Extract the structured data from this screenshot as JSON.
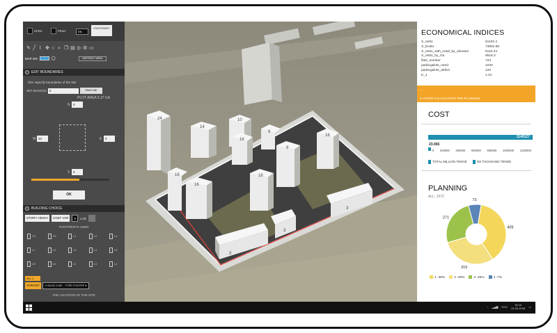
{
  "app": {
    "toolbar": {
      "open": "OPEN",
      "print": "PRINT",
      "lang": "EN",
      "start_reset": "START/RESET"
    },
    "map_on_label": "MAP ON",
    "abstract_label": "ABSTRACT AREA",
    "edit_boundaries": {
      "header": "EDIT BOUNDARIES",
      "hint": "-hint: Specify boundaries of the site",
      "setback_label": "SET BACK(m)",
      "setback_value": "6",
      "snapline": "SNAPLINE",
      "plot_area": "PLOT AREA 5.37 GA",
      "n_label": "N",
      "n_value": "0",
      "w_label": "W",
      "w_value": "10",
      "e_label": "E",
      "e_value": "0",
      "s_label": "S",
      "s_value": "5",
      "slider_fraction": 0.62,
      "ok": "OK"
    },
    "building_choice": {
      "header": "BUILDING CHOICE",
      "story_height": "STORY HEIGH",
      "coef_var": "COEF VAR",
      "coef_value": "0",
      "lub": "LUB",
      "footprints_used": "FOOTPRINTS USED",
      "footprints_row1": [
        "CC",
        "C3",
        "L1",
        "L2",
        "L3"
      ],
      "footprints_row2": [
        "L1",
        "L2",
        "L3",
        "L4",
        "L5"
      ],
      "footprints_row3": [
        "U2",
        "U1",
        "L2",
        "L3",
        "L4"
      ],
      "all_label": "ALL 1",
      "variant_label": "VARIANT",
      "variant_value": "0    51102.4 M2",
      "variant_type": "TYPE FOOTPF",
      "location": "THE LOCATION OF THE SITE"
    }
  },
  "map": {
    "building_labels": [
      "24",
      "14",
      "10",
      "16",
      "16",
      "9",
      "16",
      "16",
      "3",
      "3",
      "9",
      "16",
      "3"
    ]
  },
  "economical": {
    "title": "ECONOMICAL INDICES",
    "rows": [
      {
        "name": "S_netto",
        "value": "51102.4"
      },
      {
        "name": "S_brutto",
        "value": "73802.88"
      },
      {
        "name": "S_netto_with_retail_by_elevator",
        "value": "5110.24"
      },
      {
        "name": "S_netto_by_Ga",
        "value": "9516.3"
      },
      {
        "name": "flats_number",
        "value": "724"
      },
      {
        "name": "parkingslots_need",
        "value": "1030"
      },
      {
        "name": "parkingslots_deficit",
        "value": "120"
      },
      {
        "name": "K_1",
        "value": "1.44"
      }
    ],
    "orange_line1": "...",
    "orange_line2": "AFTER CALCULATING THE PLANNING"
  },
  "cost": {
    "title": "COST",
    "bar_value_label": "1140127",
    "small_value_label": "23.065",
    "ticks": [
      "0",
      "200000",
      "400000",
      "600000",
      "800000",
      "1000000",
      "1200000"
    ],
    "legend": [
      "TOTAL MILLION TENGE",
      "M2 THOUSAND TENGE"
    ],
    "colors": {
      "total": "#1e8fb0",
      "m2": "#1e8fb0"
    }
  },
  "planning": {
    "title": "PLANNING",
    "subtitle": "ALL: 1072",
    "legend": [
      "1 -38%",
      "2 -29%",
      "3 -25%",
      "4 -7%"
    ],
    "colors": [
      "#f4d75a",
      "#f3df7e",
      "#9cc24b",
      "#5b84b8"
    ]
  },
  "chart_data": {
    "type": "pie",
    "title": "PLANNING",
    "categories": [
      "1",
      "2",
      "3",
      "4"
    ],
    "values": [
      409,
      319,
      271,
      73
    ],
    "percent_labels": [
      "1 -38%",
      "2 -29%",
      "3 -25%",
      "4 -7%"
    ],
    "colors": [
      "#f4d75a",
      "#f3df7e",
      "#9cc24b",
      "#5b84b8"
    ],
    "donut": true,
    "legend_placement": "bottom"
  },
  "taskbar": {
    "time": "16:10",
    "date": "21.02.2018",
    "lang": "ENG"
  }
}
